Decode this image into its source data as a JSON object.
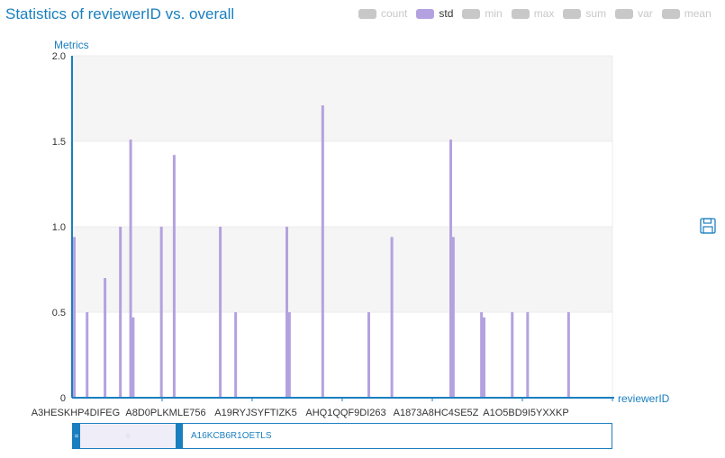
{
  "header": {
    "title": "Statistics of reviewerID vs. overall"
  },
  "legend": [
    {
      "label": "count",
      "active": false
    },
    {
      "label": "std",
      "active": true
    },
    {
      "label": "min",
      "active": false
    },
    {
      "label": "max",
      "active": false
    },
    {
      "label": "sum",
      "active": false
    },
    {
      "label": "var",
      "active": false
    },
    {
      "label": "mean",
      "active": false
    }
  ],
  "colors": {
    "accent": "#1a7fbf",
    "bar": "#b3a2df",
    "legend_inactive": "#c8c8c8",
    "band": "#f5f5f5"
  },
  "toolbar": {
    "save_icon": "save-icon"
  },
  "zoom": {
    "label": "A16KCB6R1OETLS",
    "start": 0,
    "end": 0.19
  },
  "chart_data": {
    "type": "bar",
    "title": "Statistics of reviewerID vs. overall",
    "xlabel": "reviewerID",
    "ylabel": "Metrics",
    "ylim": [
      0,
      2.0
    ],
    "yticks": [
      0,
      0.5,
      1.0,
      1.5,
      2.0
    ],
    "grid": true,
    "legend_position": "top-right",
    "x_tick_labels": [
      "A3HESKHP4DIFEG",
      "A8D0PLKMLE756",
      "A19RYJSYFTIZK5",
      "AHQ1QQF9DI263",
      "A1873A8HC4SE5Z",
      "A1O5BD9I5YXXKP"
    ],
    "series": [
      {
        "name": "std",
        "values": [
          0.94,
          0,
          0,
          0,
          0,
          0.5,
          0,
          0,
          0,
          0,
          0,
          0,
          0.7,
          0,
          0,
          0,
          0,
          0,
          1.0,
          0,
          0,
          0,
          1.51,
          0.47,
          0,
          0,
          0,
          0,
          0,
          0,
          0,
          0,
          0,
          0,
          1.0,
          0,
          0,
          0,
          0,
          1.42,
          0,
          0,
          0,
          0,
          0,
          0,
          0,
          0,
          0,
          0,
          0,
          0,
          0,
          0,
          0,
          0,
          0,
          1.0,
          0,
          0,
          0,
          0,
          0,
          0.5,
          0,
          0,
          0,
          0,
          0,
          0,
          0,
          0,
          0,
          0,
          0,
          0,
          0,
          0,
          0,
          0,
          0,
          0,
          0,
          1.0,
          0.5,
          0,
          0,
          0,
          0,
          0,
          0,
          0,
          0,
          0,
          0,
          0,
          0,
          1.71,
          0,
          0,
          0,
          0,
          0,
          0,
          0,
          0,
          0,
          0,
          0,
          0,
          0,
          0,
          0,
          0,
          0,
          0.5,
          0,
          0,
          0,
          0,
          0,
          0,
          0,
          0,
          0.94,
          0,
          0,
          0,
          0,
          0,
          0,
          0,
          0,
          0,
          0,
          0,
          0,
          0,
          0,
          0,
          0,
          0,
          0,
          0,
          0,
          0,
          0,
          1.51,
          0.94,
          0,
          0,
          0,
          0,
          0,
          0,
          0,
          0,
          0,
          0,
          0.5,
          0.47,
          0,
          0,
          0,
          0,
          0,
          0,
          0,
          0,
          0,
          0,
          0.5,
          0,
          0,
          0,
          0,
          0,
          0.5,
          0,
          0,
          0,
          0,
          0,
          0,
          0,
          0,
          0,
          0,
          0,
          0,
          0,
          0,
          0,
          0.5,
          0,
          0,
          0,
          0,
          0,
          0,
          0,
          0,
          0,
          0,
          0,
          0,
          0,
          0,
          0,
          0,
          0
        ]
      }
    ]
  }
}
